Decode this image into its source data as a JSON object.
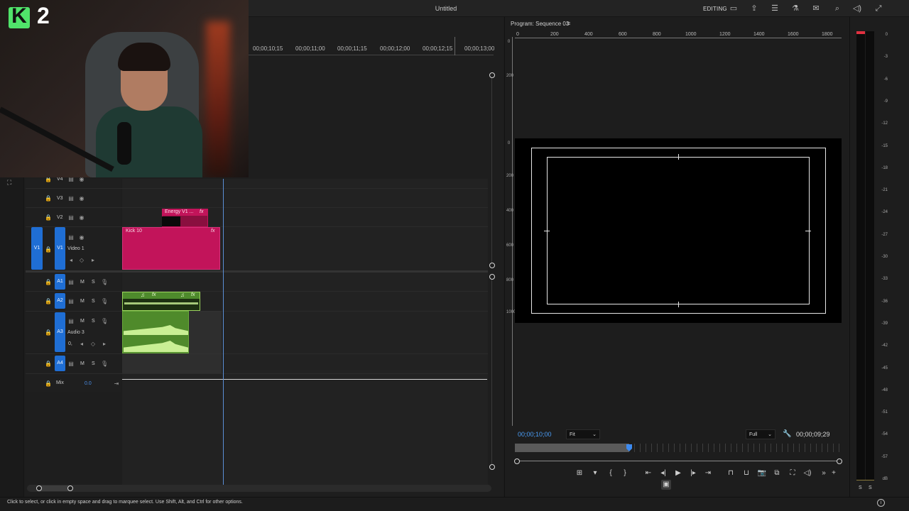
{
  "app": {
    "title": "Untitled",
    "workspace": "EDITING"
  },
  "overlay": {
    "logo_letter": "K",
    "logo_number": "2"
  },
  "timeline": {
    "ruler": [
      "00;00;10;15",
      "00;00;11;00",
      "00;00;11;15",
      "00;00;12;00",
      "00;00;12;15",
      "00;00;13;00"
    ],
    "tracks": {
      "v4": "V4",
      "v3": "V3",
      "v2": "V2",
      "v1_source": "V1",
      "v1": "V1",
      "v1_name": "Video 1",
      "a1": "A1",
      "a2": "A2",
      "a3": "A3",
      "a3_name": "Audio 3",
      "a3_value": "0,",
      "a4": "A4",
      "m": "M",
      "s": "S"
    },
    "clips": {
      "kick": "Kick 10",
      "energy": "Energy V1 ...",
      "fx": "fx"
    },
    "mix_label": "Mix",
    "mix_value": "0.0"
  },
  "program": {
    "tab_label": "Program: Sequence 03",
    "ruler_ticks": [
      "0",
      "200",
      "400",
      "600",
      "800",
      "1000",
      "1200",
      "1400",
      "1600",
      "1800"
    ],
    "vruler_groups": [
      "0",
      "200",
      "0",
      "200",
      "400",
      "600",
      "800",
      "1000"
    ],
    "timecode_current": "00;00;10;00",
    "timecode_duration": "00;00;09;29",
    "fit_label": "Fit",
    "quality_label": "Full"
  },
  "meters": {
    "db_labels": [
      "0",
      "-3",
      "-6",
      "-9",
      "-12",
      "-15",
      "-18",
      "-21",
      "-24",
      "-27",
      "-30",
      "-33",
      "-36",
      "-39",
      "-42",
      "-45",
      "-48",
      "-51",
      "-54",
      "-57",
      "dB"
    ],
    "solo_left": "S",
    "solo_right": "S"
  },
  "status": {
    "text": "Click to select, or click in empty space and drag to marquee select. Use Shift, Alt, and Ctrl for other options."
  }
}
